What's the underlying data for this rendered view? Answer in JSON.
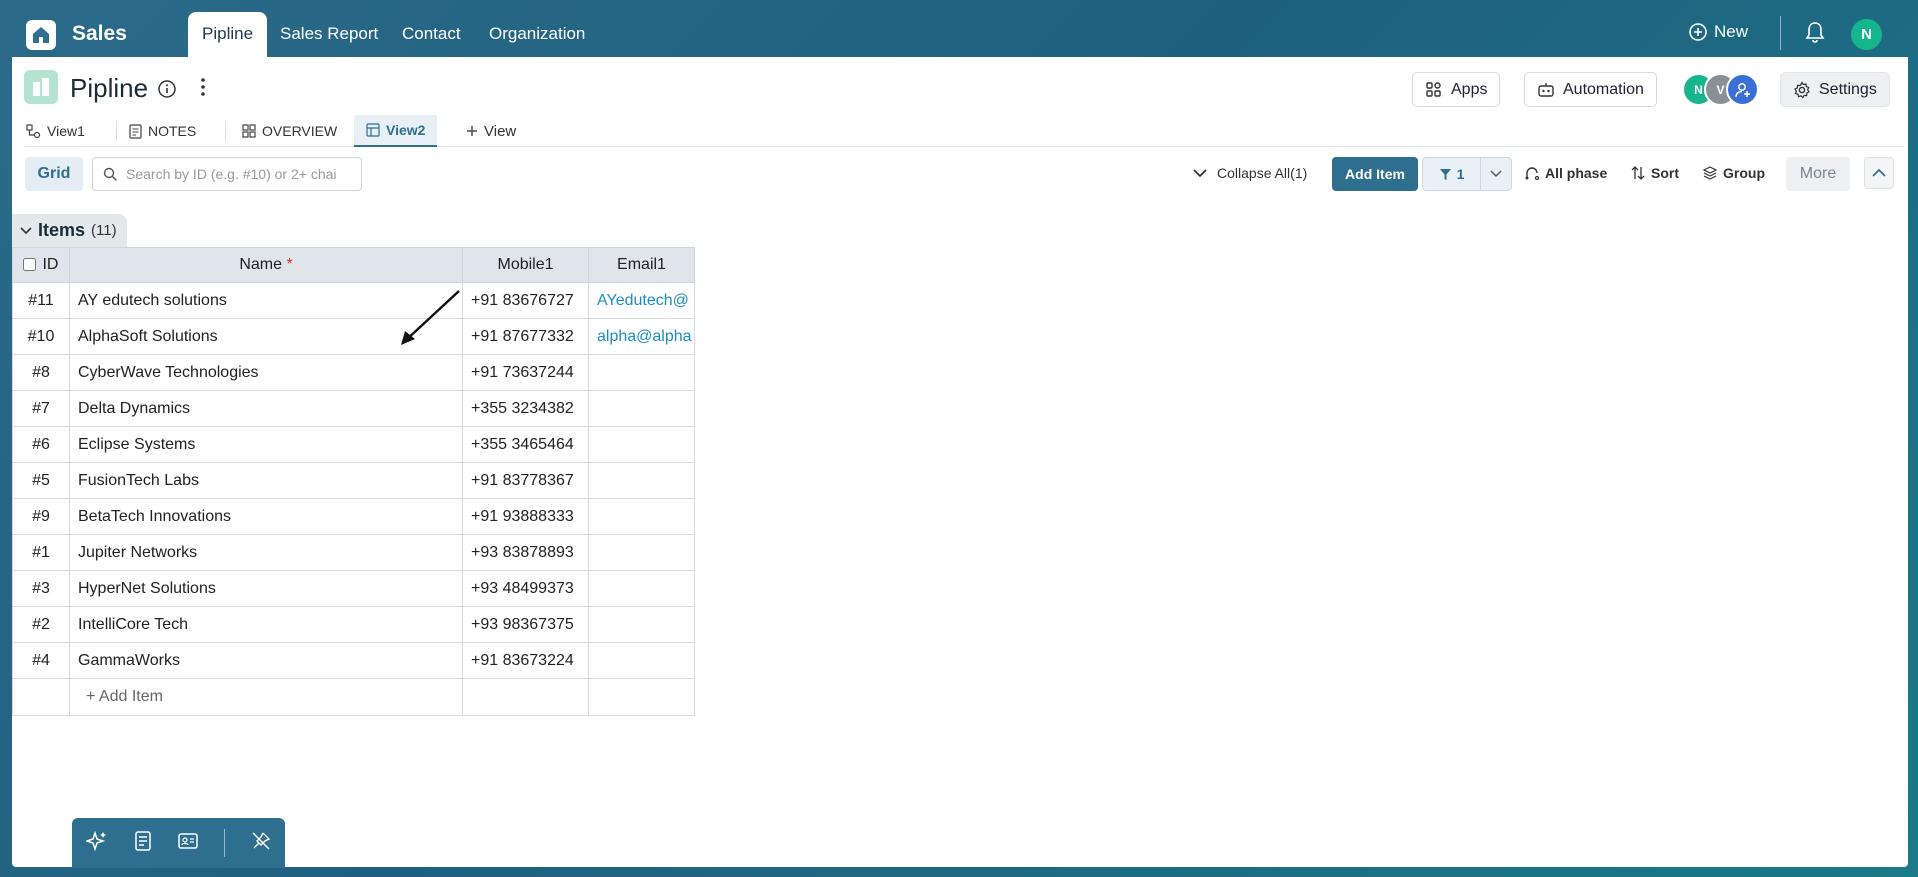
{
  "app": {
    "title": "Sales"
  },
  "nav": {
    "tabs": [
      "Pipline",
      "Sales Report",
      "Contact",
      "Organization"
    ],
    "new_label": "New",
    "avatar": "N"
  },
  "page": {
    "title": "Pipline"
  },
  "header_buttons": {
    "apps": "Apps",
    "automation": "Automation",
    "settings": "Settings"
  },
  "members": [
    "N",
    "V"
  ],
  "views": {
    "tabs": [
      "View1",
      "NOTES",
      "OVERVIEW",
      "View2"
    ],
    "add_view": "View"
  },
  "toolbar": {
    "grid": "Grid",
    "search_placeholder": "Search by ID (e.g. #10) or 2+ chai",
    "collapse_all": "Collapse All(1)",
    "add_item": "Add Item",
    "filter_count": "1",
    "all_phase": "All phase",
    "sort": "Sort",
    "group": "Group",
    "more": "More"
  },
  "group": {
    "name": "Items",
    "count": "(11)"
  },
  "table": {
    "columns": [
      "ID",
      "Name",
      "Mobile1",
      "Email1"
    ],
    "rows": [
      {
        "id": "#11",
        "name": "AY edutech solutions",
        "mobile": "+91 83676727",
        "email": "AYedutech@"
      },
      {
        "id": "#10",
        "name": "AlphaSoft Solutions",
        "mobile": "+91 87677332",
        "email": "alpha@alpha"
      },
      {
        "id": "#8",
        "name": "CyberWave Technologies",
        "mobile": "+91 73637244",
        "email": ""
      },
      {
        "id": "#7",
        "name": "Delta Dynamics",
        "mobile": "+355 3234382",
        "email": ""
      },
      {
        "id": "#6",
        "name": "Eclipse Systems",
        "mobile": "+355 3465464",
        "email": ""
      },
      {
        "id": "#5",
        "name": "FusionTech Labs",
        "mobile": "+91 83778367",
        "email": ""
      },
      {
        "id": "#9",
        "name": "BetaTech Innovations",
        "mobile": "+91 93888333",
        "email": ""
      },
      {
        "id": "#1",
        "name": "Jupiter Networks",
        "mobile": "+93 83878893",
        "email": ""
      },
      {
        "id": "#3",
        "name": "HyperNet Solutions",
        "mobile": "+93 48499373",
        "email": ""
      },
      {
        "id": "#2",
        "name": "IntelliCore Tech",
        "mobile": "+93 98367375",
        "email": ""
      },
      {
        "id": "#4",
        "name": "GammaWorks",
        "mobile": "+91 83673224",
        "email": ""
      }
    ],
    "add_item": "+ Add Item"
  },
  "colors": {
    "primary": "#2e6e8e",
    "link": "#1b8dc4",
    "required": "#d62c2c",
    "avatar_green": "#17b58e",
    "avatar_gray": "#8a9196",
    "avatar_blue": "#3a6fd8"
  }
}
